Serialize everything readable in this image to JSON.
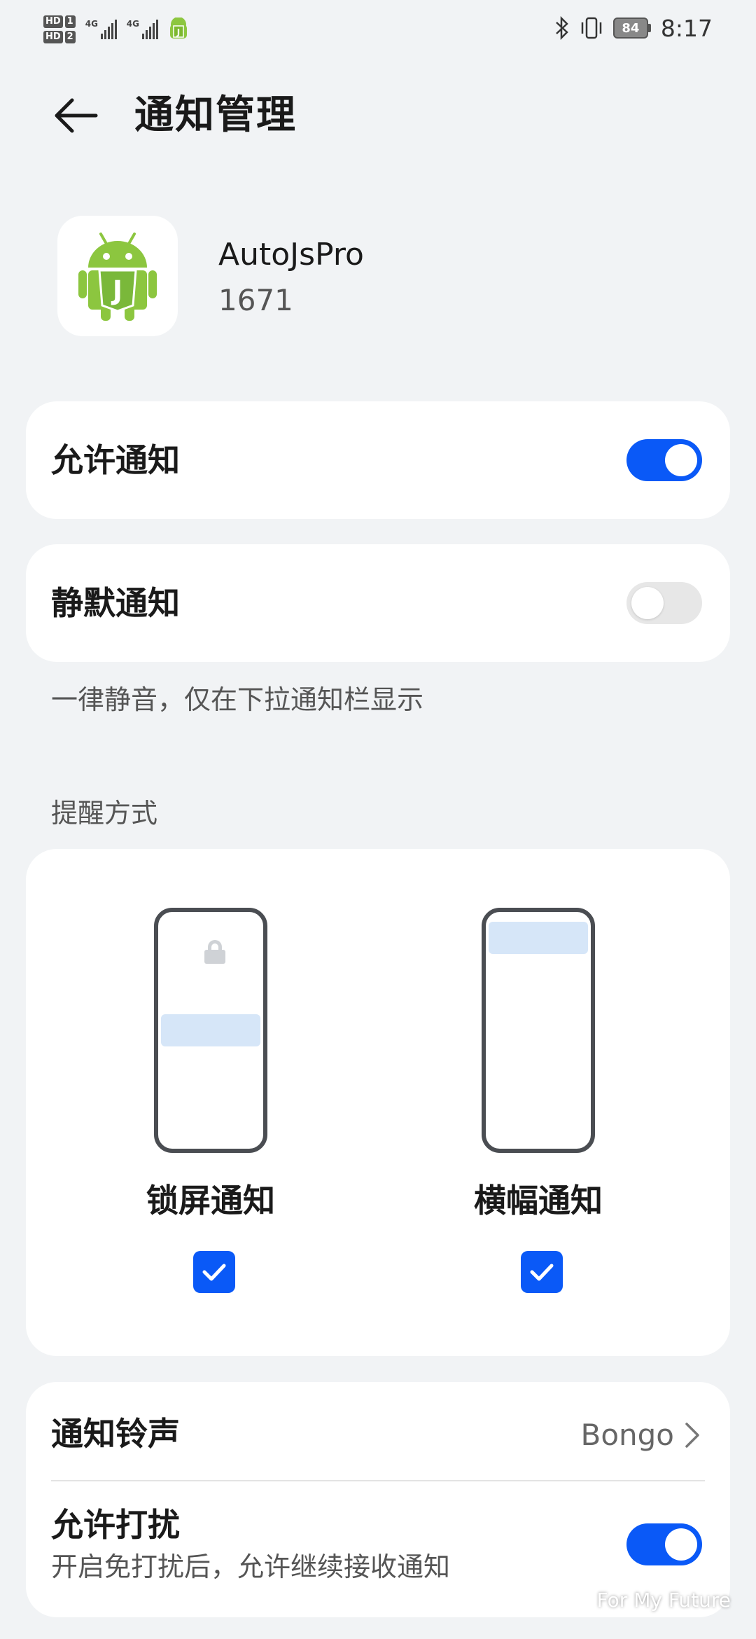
{
  "status_bar": {
    "sim1": "HD",
    "sim1_num": "1",
    "sim2": "HD",
    "sim2_num": "2",
    "net1": "4G",
    "net2": "4G",
    "battery": "84",
    "time": "8:17"
  },
  "header": {
    "title": "通知管理",
    "back_icon": "arrow-left-icon"
  },
  "app": {
    "name": "AutoJsPro",
    "version": "1671",
    "icon": "android-js-icon"
  },
  "allow_notifications": {
    "label": "允许通知",
    "enabled": true
  },
  "silent_notifications": {
    "label": "静默通知",
    "enabled": false,
    "hint": "一律静音，仅在下拉通知栏显示"
  },
  "reminder": {
    "section_title": "提醒方式",
    "options": [
      {
        "label": "锁屏通知",
        "checked": true
      },
      {
        "label": "横幅通知",
        "checked": true
      }
    ]
  },
  "ringtone": {
    "label": "通知铃声",
    "value": "Bongo"
  },
  "do_not_disturb": {
    "label": "允许打扰",
    "description": "开启免打扰后，允许继续接收通知",
    "enabled": true
  },
  "watermark": {
    "text": "For My Future"
  },
  "colors": {
    "accent": "#0a59f7",
    "background": "#f1f3f5",
    "card": "#ffffff"
  }
}
